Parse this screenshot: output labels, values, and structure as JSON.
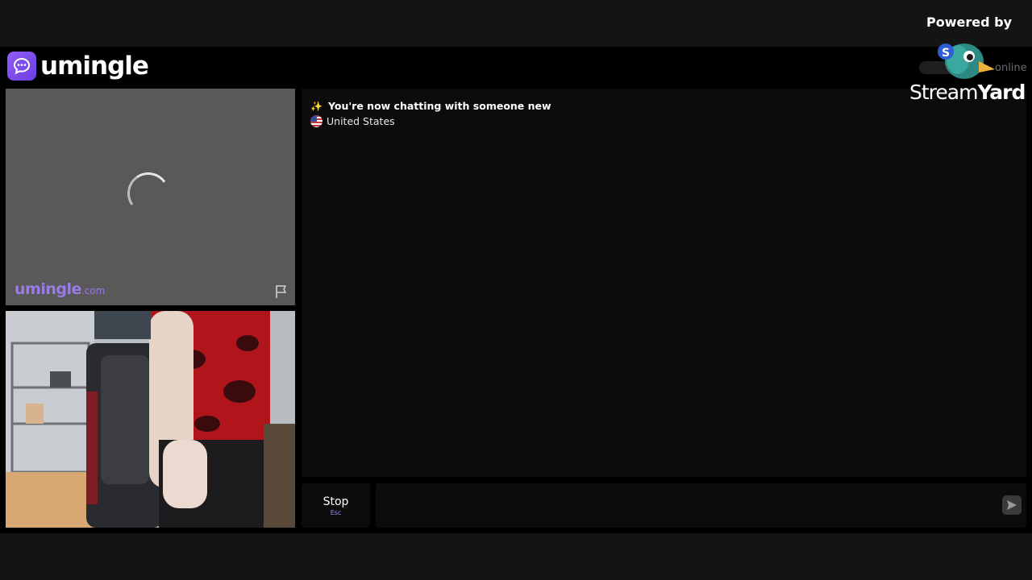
{
  "app": {
    "name": "umingle",
    "online_label": "online"
  },
  "remote": {
    "watermark_main": "umingle",
    "watermark_suffix": ".com"
  },
  "chat": {
    "system_message": "You're now chatting with someone new",
    "country": "United States",
    "input_value": ""
  },
  "controls": {
    "stop_label": "Stop",
    "stop_shortcut": "Esc"
  },
  "overlay": {
    "powered_by": "Powered by",
    "brand_part1": "Stream",
    "brand_part2": "Yard"
  },
  "colors": {
    "accent": "#8f5cf7",
    "background": "#000000"
  }
}
